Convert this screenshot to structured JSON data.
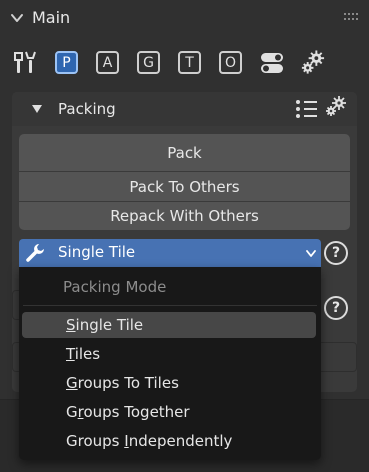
{
  "main": {
    "title": "Main",
    "tools": [
      {
        "icon": "wrench-screwdriver-icon"
      },
      {
        "letter": "P",
        "active": true
      },
      {
        "letter": "A"
      },
      {
        "letter": "G"
      },
      {
        "letter": "T"
      },
      {
        "letter": "O"
      },
      {
        "icon": "toggle-icon"
      },
      {
        "icon": "gears-icon"
      }
    ]
  },
  "packing": {
    "title": "Packing",
    "buttons": {
      "pack": "Pack",
      "pack_to_others": "Pack To Others",
      "repack_with_others": "Repack With Others"
    },
    "mode_dropdown": {
      "value": "Single Tile",
      "help": "?"
    },
    "menu": {
      "heading": "Packing Mode",
      "items": [
        {
          "pre": "",
          "key": "S",
          "post": "ingle Tile",
          "selected": true
        },
        {
          "pre": "",
          "key": "T",
          "post": "iles",
          "selected": false
        },
        {
          "pre": "",
          "key": "G",
          "post": "roups To Tiles",
          "selected": false
        },
        {
          "pre": "G",
          "key": "r",
          "post": "oups Together",
          "selected": false
        },
        {
          "pre": "Groups ",
          "key": "I",
          "post": "ndependently",
          "selected": false
        }
      ]
    }
  },
  "colors": {
    "accent": "#4772b3",
    "active_tool": "#2f66b0",
    "panel": "#303030",
    "menu_bg": "#181818"
  }
}
